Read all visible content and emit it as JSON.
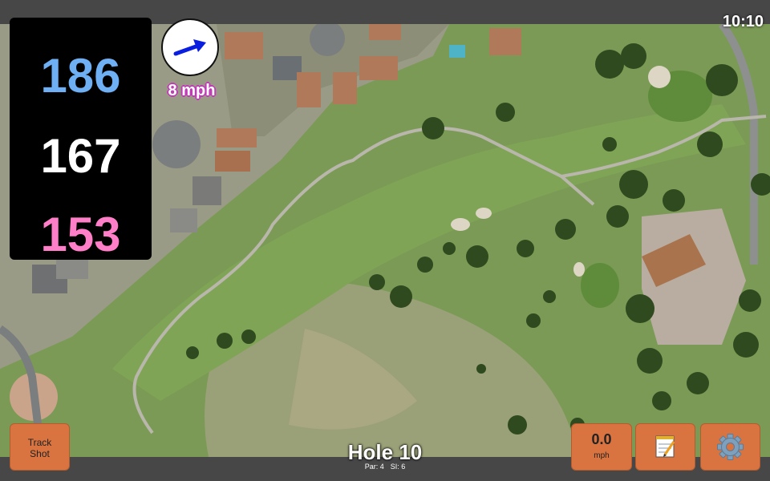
{
  "status": {
    "time": "10:10"
  },
  "distances": {
    "back": "186",
    "middle": "167",
    "front": "153"
  },
  "wind": {
    "speed": "8 mph",
    "direction_icon": "wind-arrow-icon"
  },
  "buttons": {
    "track_shot": "Track\nShot",
    "speed_value": "0.0",
    "speed_unit": "mph"
  },
  "hole": {
    "title": "Hole 10",
    "par": "Par: 4",
    "si": "SI: 6"
  },
  "colors": {
    "back": "#6fb0f5",
    "middle": "#ffffff",
    "front": "#ff7ec8",
    "button": "#d97440",
    "wind_label_outline": "#c13bb7",
    "arrow": "#0a1ee0"
  }
}
